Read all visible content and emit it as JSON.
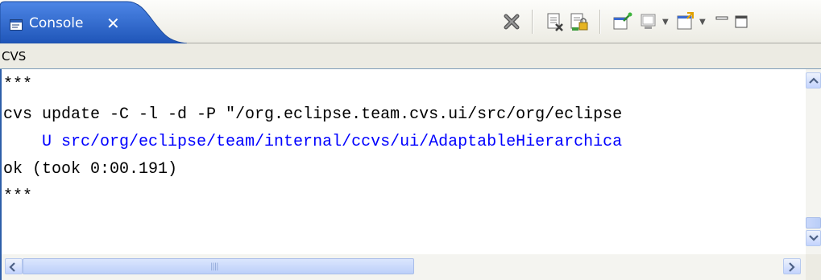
{
  "view": {
    "tab_label": "Console",
    "tab_close_glyph": "✕",
    "description": "CVS"
  },
  "toolbar": {
    "buttons": [
      {
        "name": "remove-launch-icon",
        "tooltip": "Remove"
      },
      {
        "name": "clear-console-icon",
        "tooltip": "Clear Console"
      },
      {
        "name": "scroll-lock-icon",
        "tooltip": "Scroll Lock"
      },
      {
        "name": "pin-console-icon",
        "tooltip": "Pin Console"
      },
      {
        "name": "display-selected-console-icon",
        "tooltip": "Display Selected Console"
      },
      {
        "name": "open-console-icon",
        "tooltip": "Open Console"
      }
    ],
    "window_controls": [
      "minimize-icon",
      "maximize-icon"
    ]
  },
  "console": {
    "lines": [
      {
        "text": "***",
        "color": "#000000"
      },
      {
        "text": "cvs update -C -l -d -P \"/org.eclipse.team.cvs.ui/src/org/eclipse",
        "color": "#000000"
      },
      {
        "text": "    U src/org/eclipse/team/internal/ccvs/ui/AdaptableHierarchica",
        "color": "#0000ff"
      },
      {
        "text": "ok (took 0:00.191)",
        "color": "#000000"
      },
      {
        "text": "***",
        "color": "#000000"
      }
    ]
  },
  "colors": {
    "tab_active": "#2b63c9",
    "frame_border": "#2d5ea9",
    "background": "#ecebe3",
    "cvs_output_blue": "#0000ff"
  }
}
